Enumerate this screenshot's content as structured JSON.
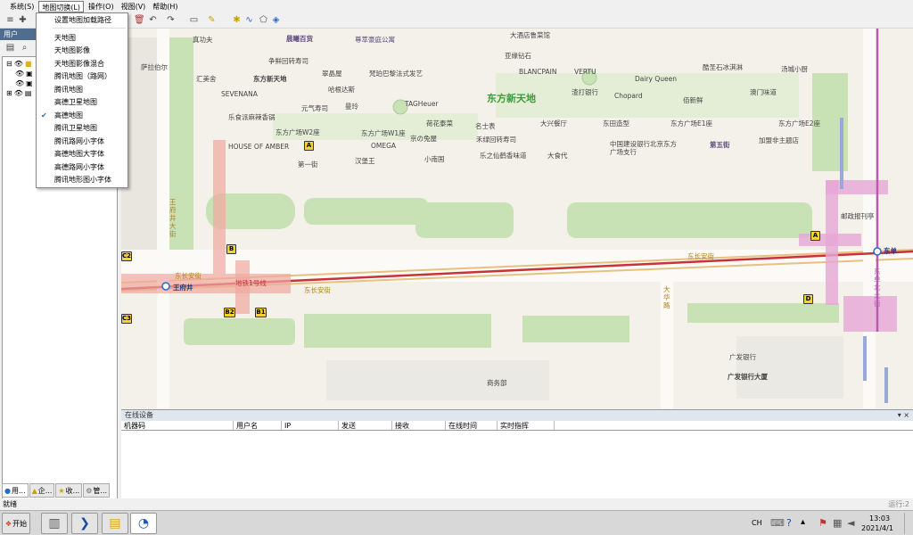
{
  "menubar": {
    "items": [
      "系统(S)",
      "地图切换(L)",
      "操作(O)",
      "视图(V)",
      "帮助(H)"
    ]
  },
  "dropdown": {
    "items": [
      "设置地图加载路径",
      "天地图",
      "天地图影像",
      "天地图影像混合",
      "腾讯地图（路网）",
      "腾讯地图",
      "高德卫星地图",
      "高德地图",
      "腾讯卫星地图",
      "腾讯路网小字体",
      "高德地图大字体",
      "高德路网小字体",
      "腾讯地形图小字体"
    ],
    "checked_item": "高德地图"
  },
  "left_panel": {
    "title": "用户",
    "tabs": [
      "用...",
      "企...",
      "收...",
      "管..."
    ]
  },
  "map": {
    "area_name": "东方新天地",
    "labels": [
      "真功夫",
      "晨曦百货",
      "尊萃豪庭公寓",
      "大酒店鲁菜馆",
      "萨拉伯尔",
      "争鲜回转寿司",
      "翠晶屋",
      "梵珀巴黎法式发艺",
      "亚缘钻石",
      "BLANCPAIN",
      "VERTU",
      "酷圣石冰淇淋",
      "汤城小厨",
      "汇美舍",
      "东方新天地",
      "Dairy Queen",
      "哈根达斯",
      "渣打银行",
      "Chopard",
      "佰新鲜",
      "澳门味道",
      "SEVENANA",
      "元气寿司",
      "曼玲",
      "TAGHeuer",
      "乐食派麻辣香锅",
      "东方广场W2座",
      "荷花泰菜",
      "名士表",
      "大兴餐厅",
      "东田造型",
      "东方广场E1座",
      "东方广场E2座",
      "HOUSE OF AMBER",
      "东方广场W1座",
      "京の兔屋",
      "禾绿回转寿司",
      "中国建设银行北京东方广场支行",
      "第五街",
      "加盟非主题店",
      "OMEGA",
      "第一街",
      "汉堡王",
      "小南国",
      "乐之仙鹤香味道",
      "大食代",
      "王府井大街",
      "东长安街",
      "地铁1号线",
      "王府井",
      "邮政报刊亭",
      "东单",
      "东单北大街",
      "大华路",
      "广发银行",
      "广发银行大厦",
      "商务部",
      "东长安街",
      "东长安街"
    ],
    "station_tags": [
      "A",
      "B",
      "C2",
      "C3",
      "B2",
      "B1",
      "A",
      "D"
    ]
  },
  "online_devices": {
    "title": "在线设备",
    "columns": [
      "机器码",
      "用户名",
      "IP",
      "发送",
      "接收",
      "在线时间",
      "实时指挥"
    ]
  },
  "status": {
    "left": "就绪",
    "right": "运行:2"
  },
  "taskbar": {
    "start_label": "开始",
    "ime": "CH",
    "time": "13:03",
    "date": "2021/4/1"
  }
}
